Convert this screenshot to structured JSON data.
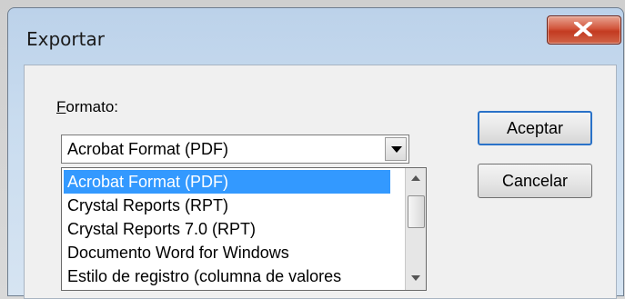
{
  "window": {
    "title": "Exportar"
  },
  "form": {
    "format_label_accel": "F",
    "format_label_rest": "ormato:",
    "combo_value": "Acrobat Format (PDF)",
    "options": [
      "Acrobat Format (PDF)",
      "Crystal Reports (RPT)",
      "Crystal Reports 7.0  (RPT)",
      "Documento Word for Windows",
      "Estilo de registro (columna de valores"
    ],
    "selected_index": 0
  },
  "buttons": {
    "accept_label": "Aceptar",
    "cancel_label": "Cancelar"
  },
  "colors": {
    "selection": "#3399ff",
    "close_button": "#c33a20"
  }
}
